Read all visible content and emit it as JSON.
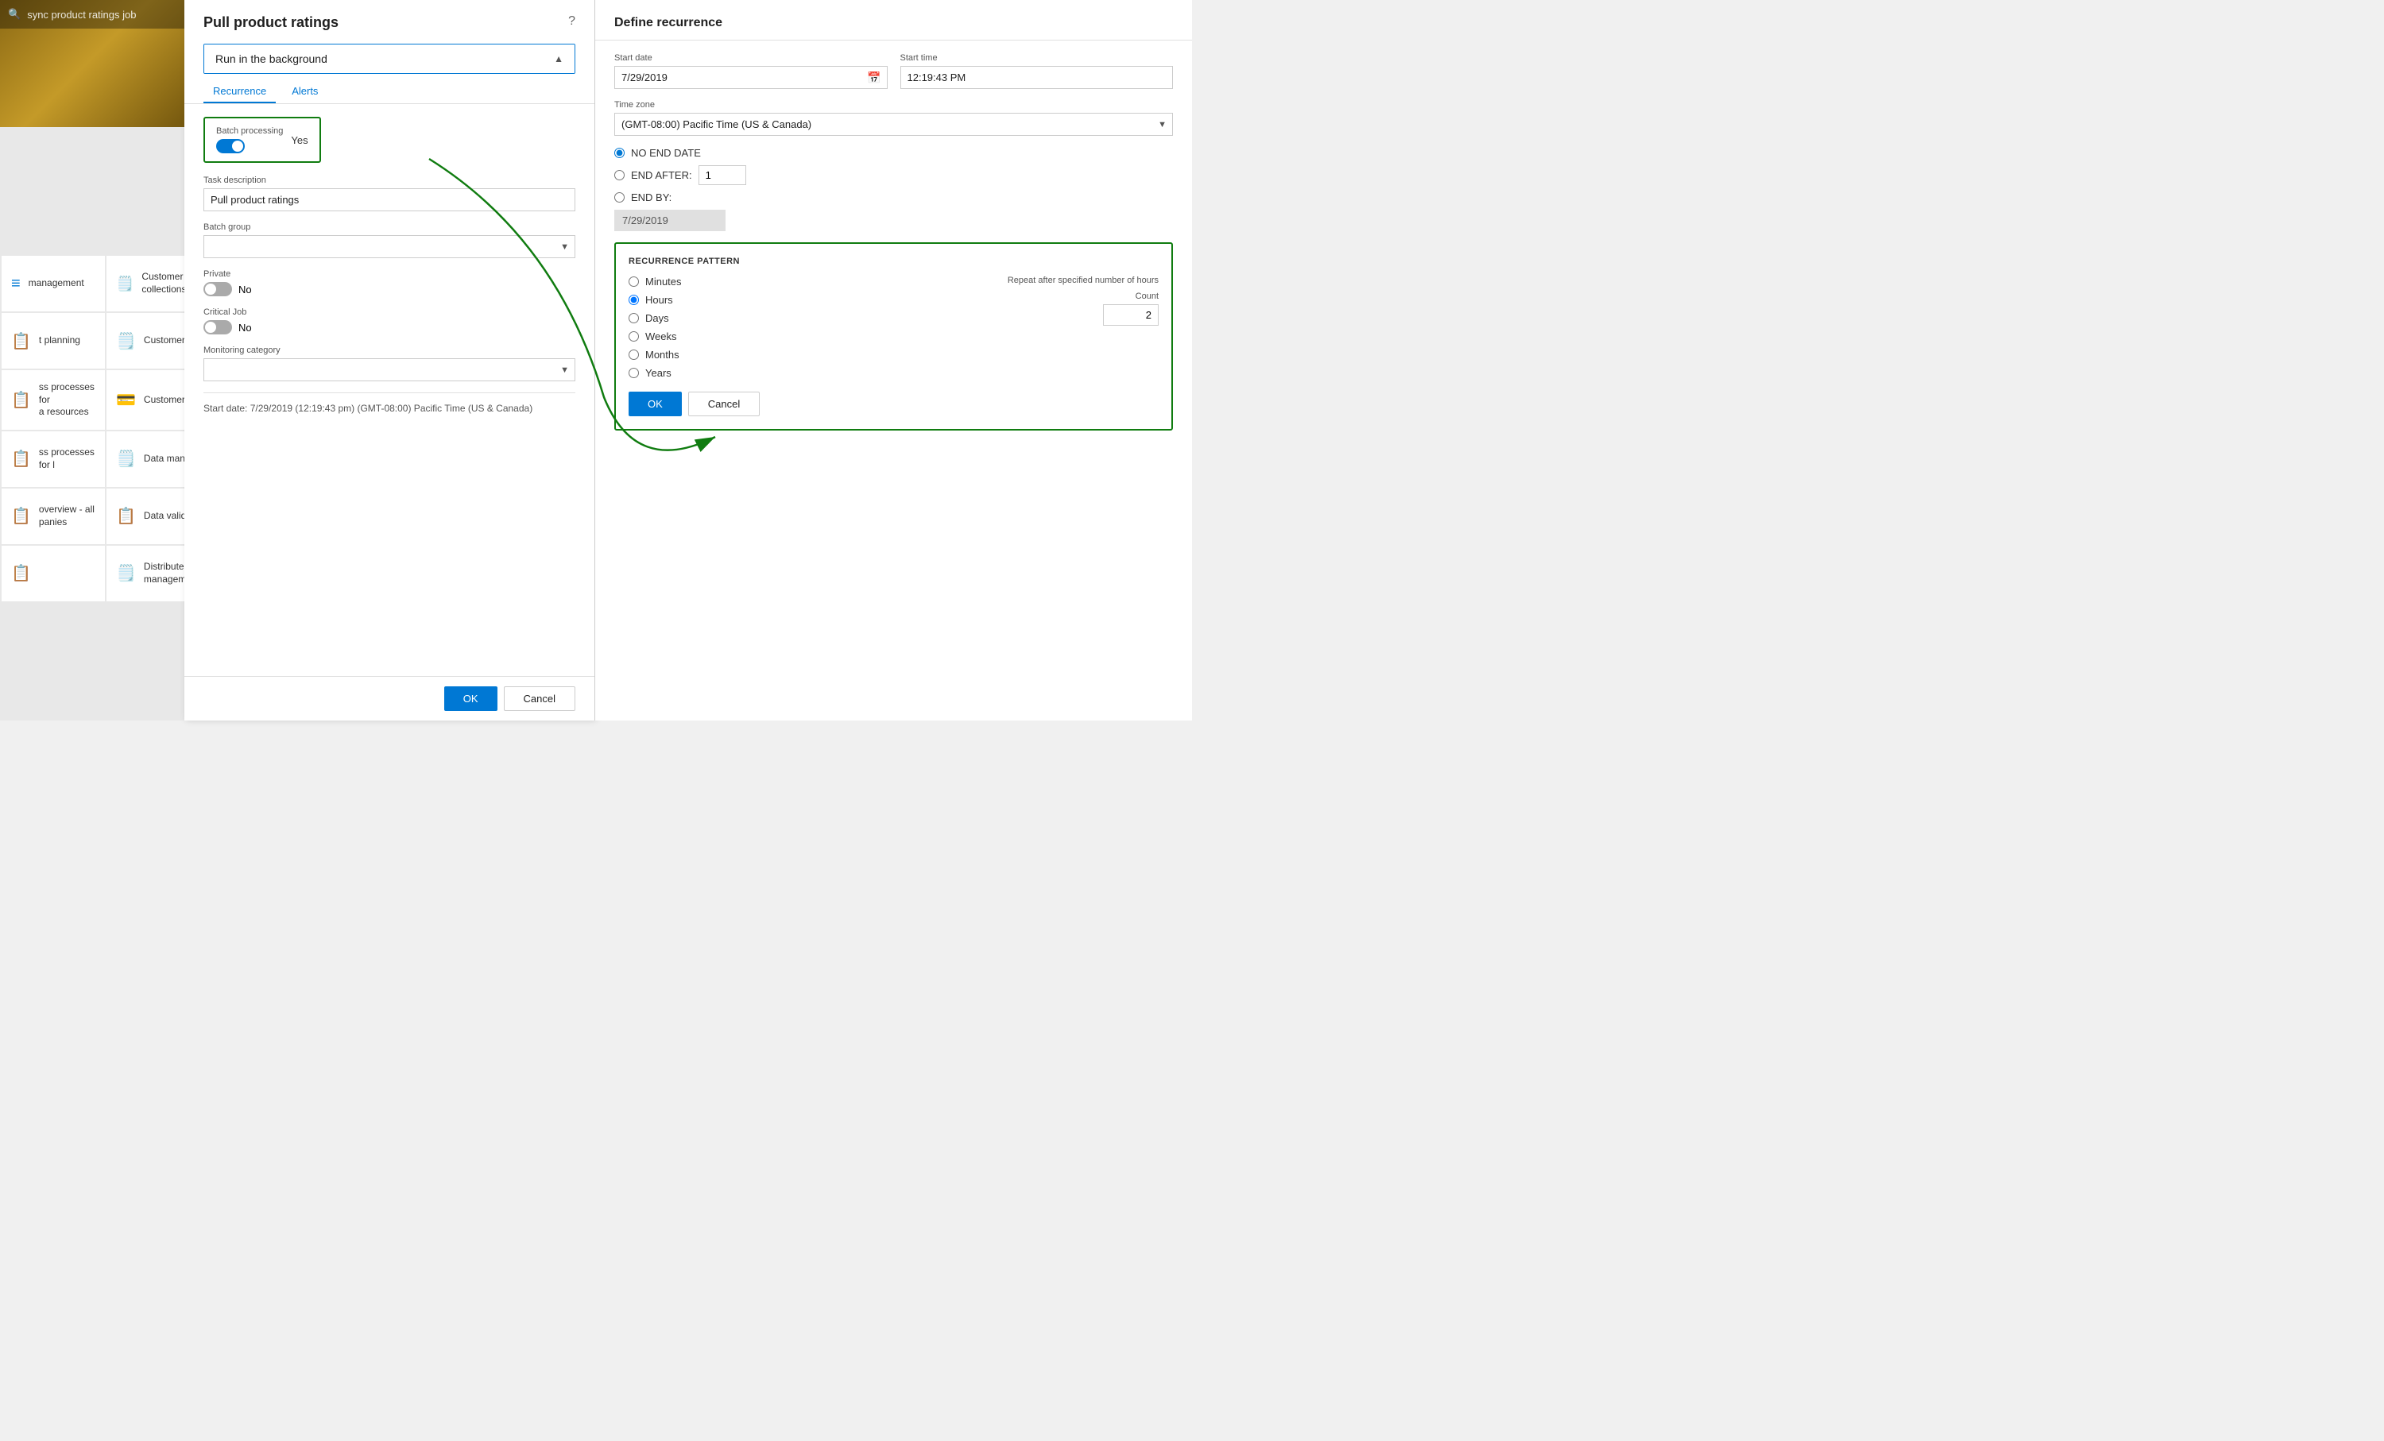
{
  "search": {
    "placeholder": "sync product ratings job"
  },
  "tiles": [
    {
      "id": "t1",
      "label": "management",
      "icon": "≡"
    },
    {
      "id": "t2",
      "label": "Customer credit and collections",
      "icon": "🗒"
    },
    {
      "id": "t3",
      "label": "",
      "icon": "⚙"
    },
    {
      "id": "t4",
      "label": "t planning",
      "icon": "📋"
    },
    {
      "id": "t5",
      "label": "Customer invoicing",
      "icon": "🗒"
    },
    {
      "id": "t6",
      "label": "",
      "icon": "👤"
    },
    {
      "id": "t7",
      "label": "ss processes for a resources",
      "icon": "📋"
    },
    {
      "id": "t8",
      "label": "Customer payments",
      "icon": "💳"
    },
    {
      "id": "t9",
      "label": "",
      "icon": "≡"
    },
    {
      "id": "t10",
      "label": "ss processes for l",
      "icon": "📋"
    },
    {
      "id": "t11",
      "label": "Data management",
      "icon": "🗒"
    },
    {
      "id": "t12",
      "label": "",
      "icon": "🔧"
    },
    {
      "id": "t13",
      "label": "overview - all panies",
      "icon": "📋"
    },
    {
      "id": "t14",
      "label": "Data validation checklist",
      "icon": "📋"
    },
    {
      "id": "t15",
      "label": "",
      "icon": "📅"
    },
    {
      "id": "t16",
      "label": "",
      "icon": "📋"
    },
    {
      "id": "t17",
      "label": "Distributed order management",
      "icon": "🗒"
    },
    {
      "id": "t18",
      "label": "",
      "icon": "👥"
    }
  ],
  "dialog": {
    "title": "Pull product ratings",
    "help_icon": "?",
    "run_in_background_label": "Run in the background",
    "tabs": [
      "Recurrence",
      "Alerts"
    ],
    "batch_processing_label": "Batch processing",
    "batch_processing_value": "Yes",
    "task_description_label": "Task description",
    "task_description_value": "Pull product ratings",
    "batch_group_label": "Batch group",
    "batch_group_value": "",
    "private_label": "Private",
    "private_value": "No",
    "critical_job_label": "Critical Job",
    "critical_job_value": "No",
    "monitoring_category_label": "Monitoring category",
    "monitoring_category_value": "",
    "start_date_info": "Start date: 7/29/2019 (12:19:43 pm) (GMT-08:00) Pacific Time (US & Canada)",
    "ok_label": "OK",
    "cancel_label": "Cancel"
  },
  "recurrence": {
    "title": "Define recurrence",
    "start_date_label": "Start date",
    "start_date_value": "7/29/2019",
    "start_time_label": "Start time",
    "start_time_value": "12:19:43 PM",
    "time_zone_label": "Time zone",
    "time_zone_value": "(GMT-08:00) Pacific Time (US & Canada)",
    "no_end_date_label": "NO END DATE",
    "end_after_label": "END AFTER:",
    "end_after_count": "1",
    "end_by_label": "END BY:",
    "end_by_date": "7/29/2019",
    "pattern_title": "RECURRENCE PATTERN",
    "pattern_hint": "Repeat after specified number of hours",
    "pattern_options": [
      "Minutes",
      "Hours",
      "Days",
      "Weeks",
      "Months",
      "Years"
    ],
    "selected_pattern": "Hours",
    "count_label": "Count",
    "count_value": "2",
    "ok_label": "OK",
    "cancel_label": "Cancel"
  }
}
